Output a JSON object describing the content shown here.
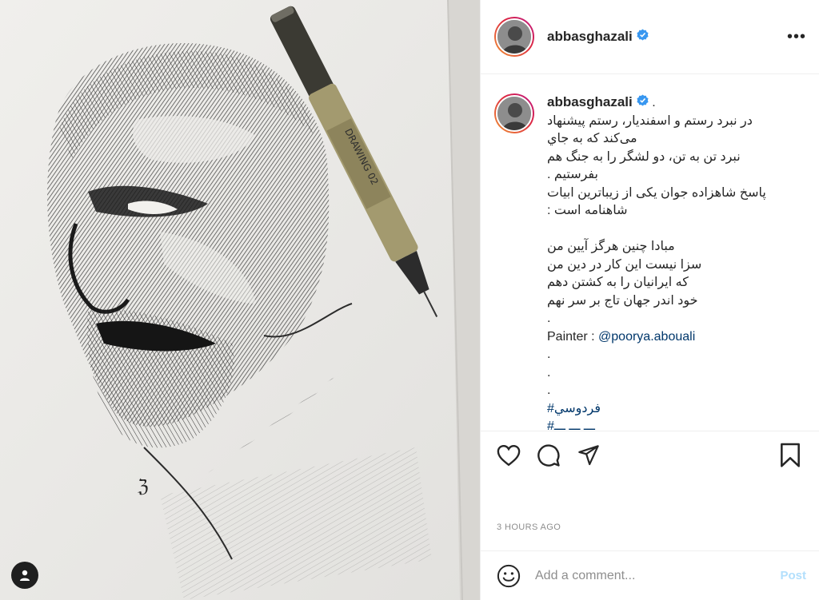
{
  "post": {
    "username": "abbasghazali",
    "caption_suffix": " .",
    "caption_lines": [
      "در نبرد رستم و اسفندیار، رستم پیشنهاد",
      "می‌کند که به جاي",
      "نبرد تن به تن، دو لشگر را به جنگ هم",
      "بفرستیم .",
      "پاسخ شاهزاده جوان یکی از زیباترین ابیات",
      "شاهنامه است :",
      "",
      "مبادا چنین هرگز آیین من",
      "سزا نیست این کار در دین من",
      "که ایرانیان را به کشتن دهم",
      "خود اندر جهان تاج بر سر نهم",
      "."
    ],
    "painter_label": "Painter : ",
    "painter_mention": "@poorya.abouali",
    "dots": [
      ".",
      ".",
      "."
    ],
    "hashtag": "#فردوسي",
    "hashtag_partial": "#ـــ ـــ ـــ",
    "time": "3 HOURS AGO"
  },
  "comment": {
    "placeholder": "Add a comment...",
    "post_label": "Post"
  },
  "icons": {
    "header": [
      "verified-badge-icon",
      "more-options-icon"
    ],
    "actions": [
      "heart-icon",
      "comment-icon",
      "share-icon",
      "bookmark-icon"
    ],
    "comment": [
      "emoji-icon"
    ],
    "photo": [
      "user-tag-icon"
    ]
  },
  "colors": {
    "verified": "#3897f0",
    "link": "#00376b",
    "muted": "#8e8e8e",
    "post_disabled": "#b2dffc"
  }
}
